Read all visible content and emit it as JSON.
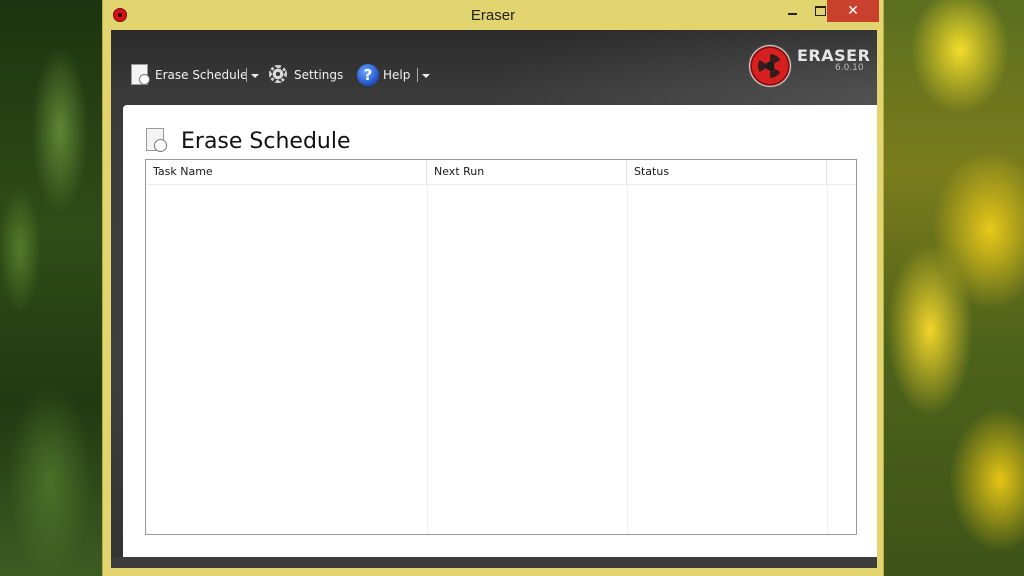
{
  "window": {
    "title": "Eraser"
  },
  "toolbar": {
    "erase_schedule_label": "Erase Schedule",
    "settings_label": "Settings",
    "help_label": "Help"
  },
  "brand": {
    "name": "ERASER",
    "version": "6.0.10"
  },
  "panel": {
    "title": "Erase Schedule"
  },
  "task_list": {
    "columns": [
      "Task Name",
      "Next Run",
      "Status",
      ""
    ],
    "rows": []
  },
  "icons": {
    "app": "eraser-app-icon",
    "erase_schedule": "schedule-document-icon",
    "settings": "gear-icon",
    "help": "help-icon"
  },
  "colors": {
    "title_bar": "#e2d46f",
    "close_button": "#c9412d",
    "toolbar_bg": "#3a3a3a",
    "brand_red": "#d62020"
  }
}
